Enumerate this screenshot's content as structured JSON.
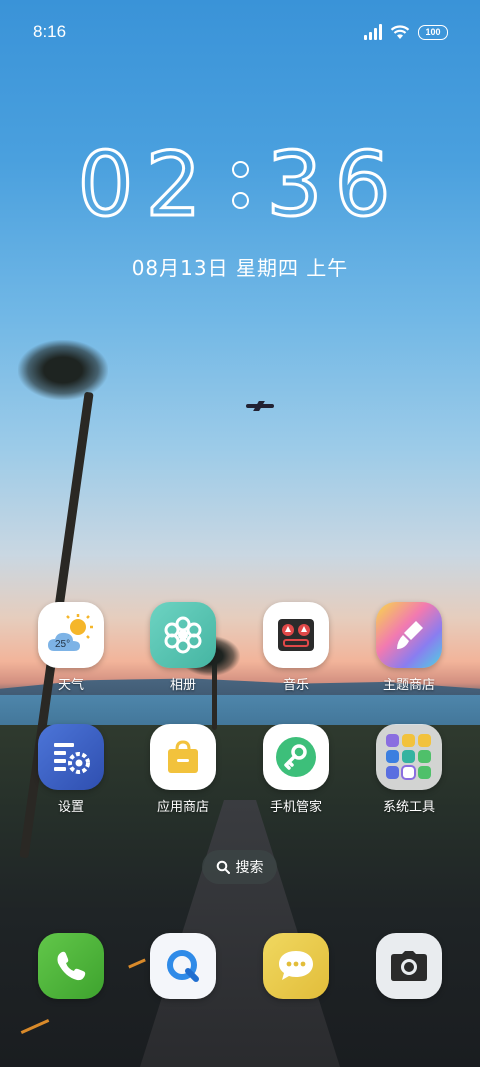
{
  "status_bar": {
    "time": "8:16",
    "battery": "100",
    "icons": [
      "signal-icon",
      "wifi-icon",
      "battery-icon"
    ]
  },
  "clock": {
    "hours": "02",
    "minutes": "36"
  },
  "date": "08月13日  星期四  上午",
  "weather_widget_temp": "25°",
  "apps_row1": [
    {
      "label": "天气",
      "icon": "weather-icon"
    },
    {
      "label": "相册",
      "icon": "gallery-icon"
    },
    {
      "label": "音乐",
      "icon": "music-icon"
    },
    {
      "label": "主题商店",
      "icon": "theme-store-icon"
    }
  ],
  "apps_row2": [
    {
      "label": "设置",
      "icon": "settings-icon"
    },
    {
      "label": "应用商店",
      "icon": "app-store-icon"
    },
    {
      "label": "手机管家",
      "icon": "phone-manager-icon"
    },
    {
      "label": "系统工具",
      "icon": "folder-icon"
    }
  ],
  "search": {
    "label": "搜索",
    "icon": "search-icon"
  },
  "dock": [
    {
      "icon": "phone-icon"
    },
    {
      "icon": "browser-icon"
    },
    {
      "icon": "messages-icon"
    },
    {
      "icon": "camera-icon"
    }
  ],
  "colors": {
    "sky_top": "#3a93d8",
    "phone_green": "#4fb33c",
    "messages_yellow": "#e8c84a",
    "settings_blue": "#3b5fc0",
    "app_store_yellow": "#f2c23c",
    "gallery_teal": "#5cc6b4"
  }
}
